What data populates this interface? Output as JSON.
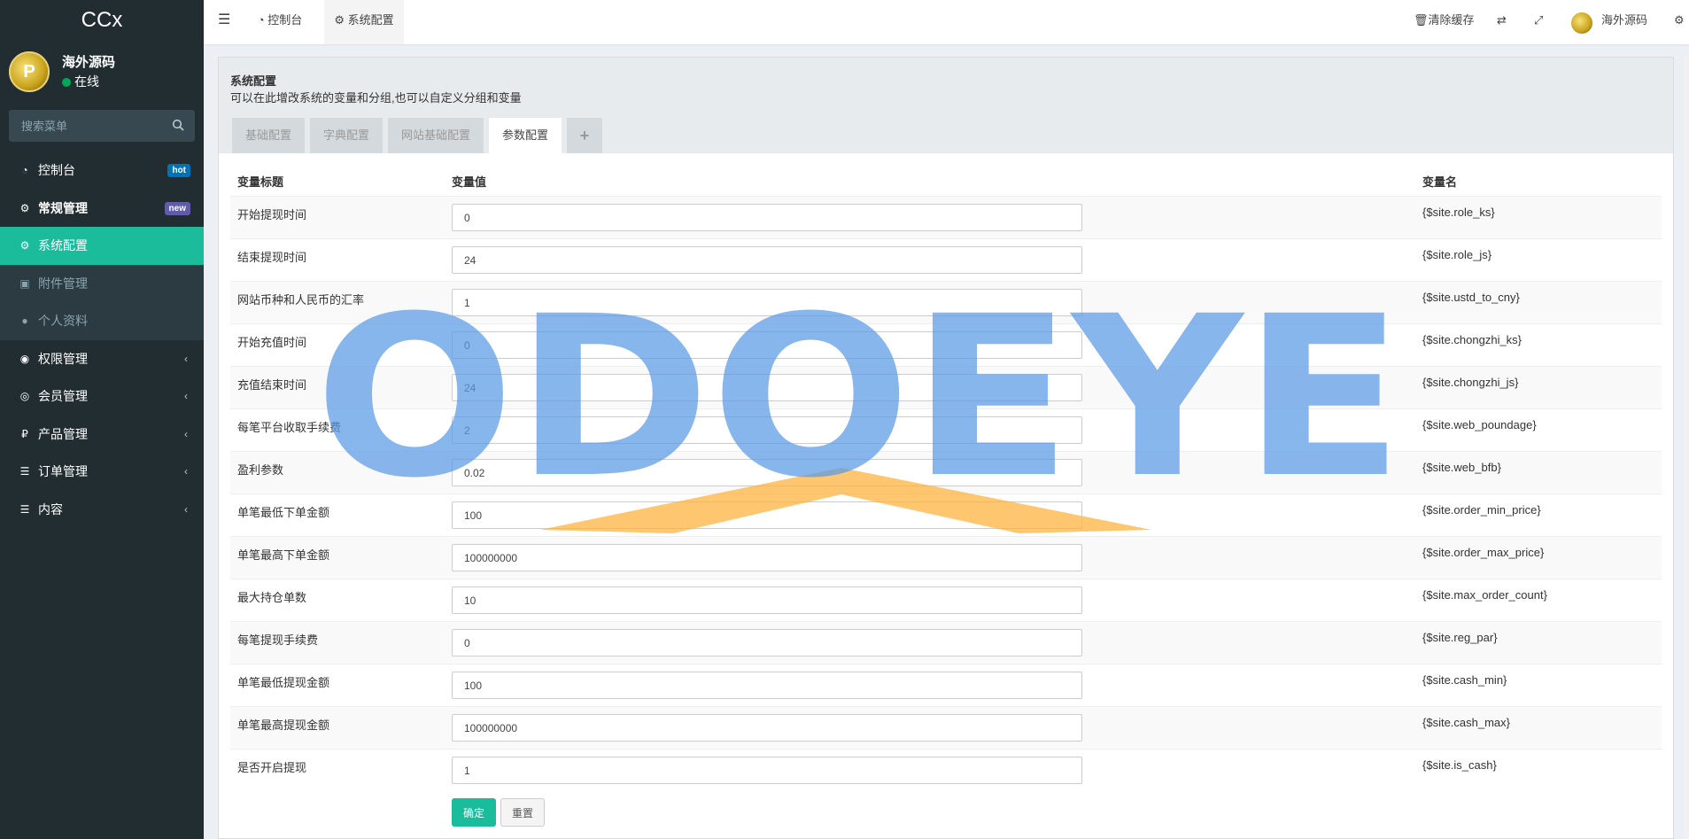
{
  "app": {
    "logo": "CCx"
  },
  "user": {
    "name": "海外源码",
    "status": "在线"
  },
  "sidebar": {
    "search_placeholder": "搜索菜单",
    "items": [
      {
        "label": "控制台",
        "badge": "hot"
      },
      {
        "label": "常规管理",
        "badge": "new"
      },
      {
        "label": "系统配置"
      },
      {
        "label": "附件管理"
      },
      {
        "label": "个人资料"
      },
      {
        "label": "权限管理"
      },
      {
        "label": "会员管理"
      },
      {
        "label": "产品管理"
      },
      {
        "label": "订单管理"
      },
      {
        "label": "内容"
      }
    ]
  },
  "topbar": {
    "tabs": [
      {
        "label": "控制台"
      },
      {
        "label": "系统配置"
      }
    ],
    "clear_cache": "清除缓存",
    "user_name": "海外源码"
  },
  "panel": {
    "title": "系统配置",
    "subtitle": "可以在此增改系统的变量和分组,也可以自定义分组和变量",
    "tabs": [
      "基础配置",
      "字典配置",
      "网站基础配置",
      "参数配置",
      "+"
    ]
  },
  "table": {
    "headers": [
      "变量标题",
      "变量值",
      "变量名"
    ],
    "rows": [
      {
        "title": "开始提现时间",
        "value": "0",
        "name": "{$site.role_ks}"
      },
      {
        "title": "结束提现时间",
        "value": "24",
        "name": "{$site.role_js}"
      },
      {
        "title": "网站币种和人民币的汇率",
        "value": "1",
        "name": "{$site.ustd_to_cny}"
      },
      {
        "title": "开始充值时间",
        "value": "0",
        "name": "{$site.chongzhi_ks}"
      },
      {
        "title": "充值结束时间",
        "value": "24",
        "name": "{$site.chongzhi_js}"
      },
      {
        "title": "每笔平台收取手续费",
        "value": "2",
        "name": "{$site.web_poundage}"
      },
      {
        "title": "盈利参数",
        "value": "0.02",
        "name": "{$site.web_bfb}"
      },
      {
        "title": "单笔最低下单金额",
        "value": "100",
        "name": "{$site.order_min_price}"
      },
      {
        "title": "单笔最高下单金额",
        "value": "100000000",
        "name": "{$site.order_max_price}"
      },
      {
        "title": "最大持仓单数",
        "value": "10",
        "name": "{$site.max_order_count}"
      },
      {
        "title": "每笔提现手续费",
        "value": "0",
        "name": "{$site.reg_par}"
      },
      {
        "title": "单笔最低提现金额",
        "value": "100",
        "name": "{$site.cash_min}"
      },
      {
        "title": "单笔最高提现金额",
        "value": "100000000",
        "name": "{$site.cash_max}"
      },
      {
        "title": "是否开启提现",
        "value": "1",
        "name": "{$site.is_cash}"
      }
    ]
  },
  "buttons": {
    "ok": "确定",
    "reset": "重置"
  },
  "watermark": "ODOEYE",
  "colors": {
    "accent": "#1abc9c",
    "sidebar": "#222d32",
    "badge_hot": "#0073b7",
    "badge_new": "#605ca8"
  }
}
